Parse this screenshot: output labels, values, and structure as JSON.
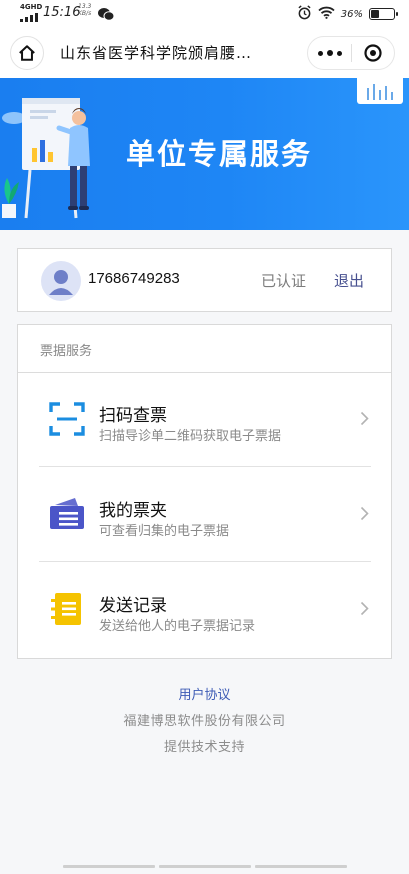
{
  "status_bar": {
    "network": "4GHD",
    "time": "15:16",
    "speed_value": "13.3",
    "speed_unit": "KB/s",
    "battery": "36%",
    "battery_level": 0.36,
    "icons": [
      "signal-icon",
      "wechat-icon",
      "alarm-icon",
      "wifi-icon",
      "battery-icon"
    ]
  },
  "nav": {
    "title": "山东省医学科学院颁肩腰…",
    "icons": [
      "home-icon",
      "more-icon",
      "close-icon"
    ]
  },
  "banner": {
    "title": "单位专属服务"
  },
  "user": {
    "phone": "17686749283",
    "status": "已认证",
    "logout": "退出"
  },
  "services": {
    "section_title": "票据服务",
    "items": [
      {
        "title": "扫码查票",
        "desc": "扫描导诊单二维码获取电子票据",
        "icon": "scan-icon",
        "color": "#1b8de0"
      },
      {
        "title": "我的票夹",
        "desc": "可查看归集的电子票据",
        "icon": "ticket-folder-icon",
        "color": "#4b55c8"
      },
      {
        "title": "发送记录",
        "desc": "发送给他人的电子票据记录",
        "icon": "send-record-icon",
        "color": "#f5c300"
      }
    ]
  },
  "footer": {
    "agreement": "用户协议",
    "company": "福建博思软件股份有限公司",
    "support": "提供技术支持"
  }
}
